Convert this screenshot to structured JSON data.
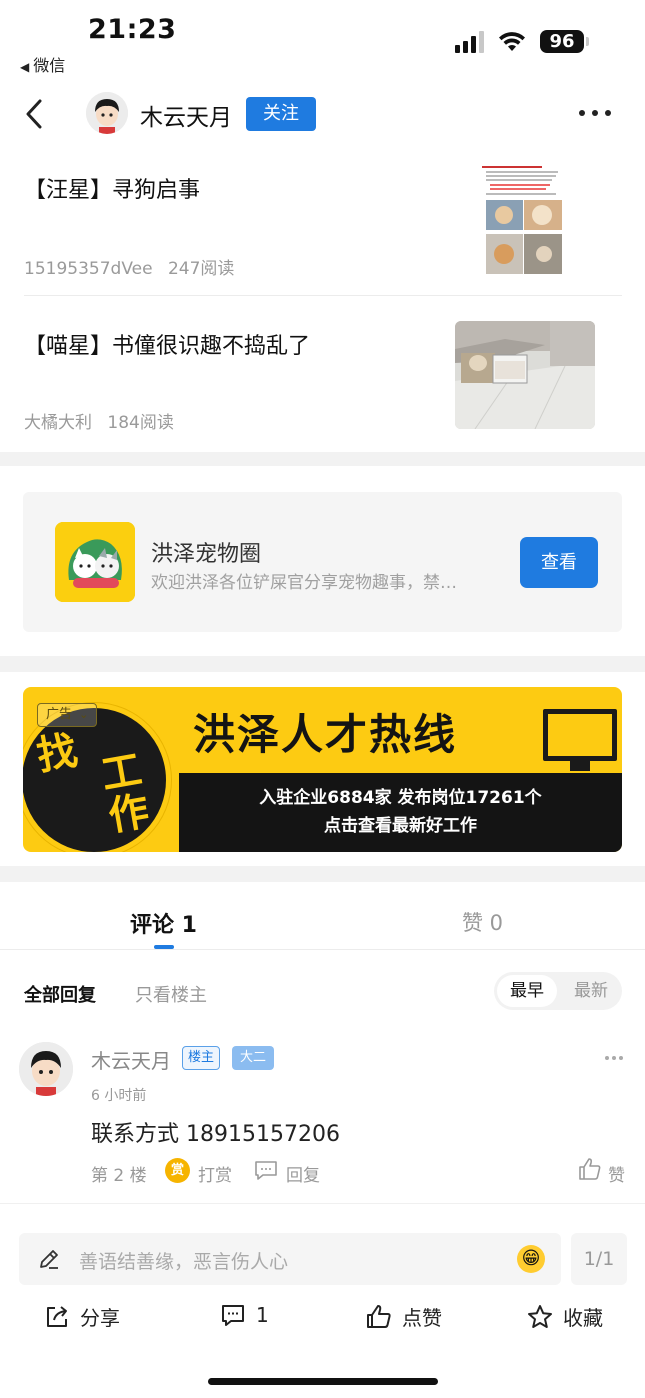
{
  "status_bar": {
    "time": "21:23",
    "back_app": "微信",
    "battery": "96"
  },
  "nav": {
    "author_name": "木云天月",
    "follow_label": "关注"
  },
  "articles": [
    {
      "title": "【汪星】寻狗启事",
      "author": "15195357dVee",
      "reads": "247阅读"
    },
    {
      "title": "【喵星】书僮很识趣不捣乱了",
      "author": "大橘大利",
      "reads": "184阅读"
    }
  ],
  "community": {
    "name": "洪泽宠物圈",
    "description": "欢迎洪泽各位铲屎官分享宠物趣事，禁…",
    "view_label": "查看"
  },
  "ad": {
    "tag": "广告",
    "circle_text": [
      "找",
      "工",
      "作"
    ],
    "title": "洪泽人才热线",
    "line1": "入驻企业6884家  发布岗位17261个",
    "line2": "点击查看最新好工作"
  },
  "tabs": {
    "comments": "评论 1",
    "likes": "赞 0"
  },
  "filters": {
    "all": "全部回复",
    "op_only": "只看楼主",
    "sort_early": "最早",
    "sort_late": "最新"
  },
  "comment": {
    "name": "木云天月",
    "badge_op": "楼主",
    "badge_level": "大二",
    "time": "6 小时前",
    "content": "联系方式 18915157206",
    "floor": "第 2 楼",
    "reward_icon": "赏",
    "reward": "打赏",
    "reply": "回复",
    "like": "赞"
  },
  "input": {
    "placeholder": "善语结善缘，恶言伤人心",
    "page": "1/1"
  },
  "actions": {
    "share": "分享",
    "comment_count": "1",
    "like": "点赞",
    "favorite": "收藏"
  },
  "colors": {
    "accent": "#1f7be0",
    "ad_yellow": "#fdcb12"
  }
}
